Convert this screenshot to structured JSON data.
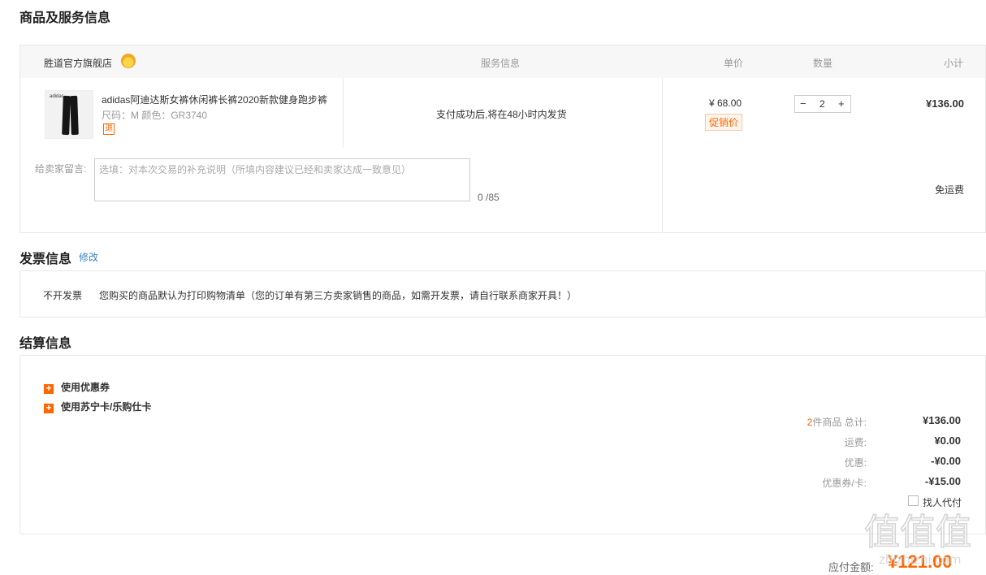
{
  "sections": {
    "goods_title": "商品及服务信息",
    "invoice_title": "发票信息",
    "settle_title": "结算信息"
  },
  "order_table": {
    "shop_name": "胜道官方旗舰店",
    "col_service": "服务信息",
    "col_price": "单价",
    "col_qty": "数量",
    "col_subtotal": "小计"
  },
  "product": {
    "thumb_logo": "adidas",
    "name": "adidas阿迪达斯女裤休闲裤长裤2020新款健身跑步裤",
    "attrs": "尺码：M   颜色：GR3740",
    "return_tag": "退",
    "service": "支付成功后,将在48小时内发货",
    "unit_price": "¥ 68.00",
    "promo_tag": "促销价",
    "qty_minus": "−",
    "qty": "2",
    "qty_plus": "+",
    "subtotal": "¥136.00"
  },
  "remark": {
    "label": "给卖家留言:",
    "placeholder": "选填：对本次交易的补充说明（所填内容建议已经和卖家达成一致意见）",
    "count": "0 /85",
    "shipping": "免运费"
  },
  "invoice": {
    "edit_link": "修改",
    "type": "不开发票",
    "note": "您购买的商品默认为打印购物清单（您的订单有第三方卖家销售的商品，如需开发票，请自行联系商家开具！）"
  },
  "settlement": {
    "coupon_label": "使用优惠券",
    "card_label": "使用苏宁卡/乐购仕卡",
    "item_count": "2",
    "total_label": "件商品 总计:",
    "total_value": "¥136.00",
    "freight_label": "运费:",
    "freight_value": "¥0.00",
    "discount_label": "优惠:",
    "discount_value": "-¥0.00",
    "coupon_card_label": "优惠券/卡:",
    "coupon_card_value": "-¥15.00",
    "proxy_label": "找人代付",
    "pay_label": "应付金额:",
    "pay_amount": "¥121.00"
  },
  "watermark": {
    "text_top": "值值值",
    "text_bottom": "zhizhizhi.com"
  },
  "colors": {
    "accent": "#ff6600",
    "link": "#3b82c4",
    "border": "#e8e8e8"
  },
  "icons": [
    "shop-badge-icon",
    "plus-expand-icon",
    "checkbox-icon"
  ]
}
